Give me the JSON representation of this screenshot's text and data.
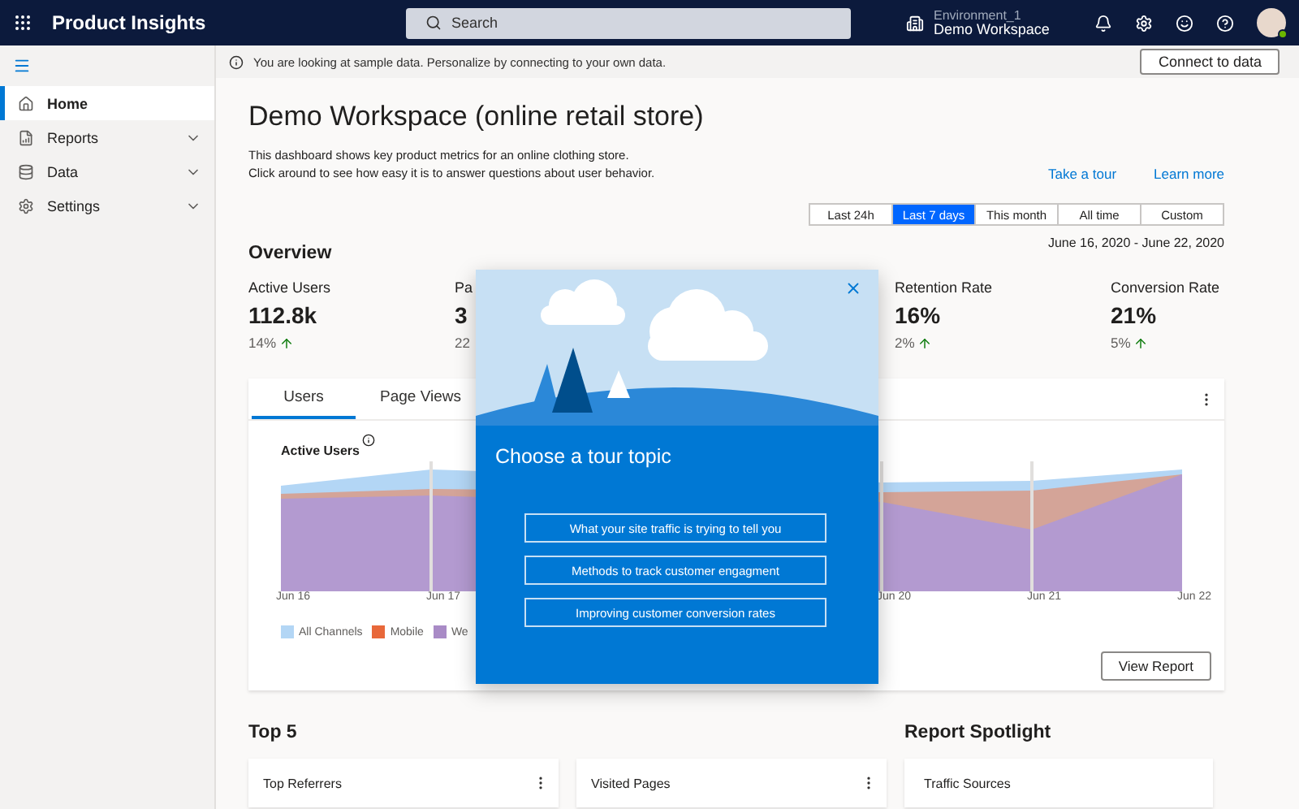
{
  "header": {
    "app_title": "Product Insights",
    "search": {
      "placeholder": "Search"
    },
    "environment": {
      "name": "Environment_1",
      "workspace": "Demo Workspace"
    }
  },
  "sidebar": {
    "items": [
      {
        "label": "Home",
        "selected": true
      },
      {
        "label": "Reports",
        "selected": false,
        "expanded": false
      },
      {
        "label": "Data",
        "selected": false,
        "expanded": false
      },
      {
        "label": "Settings",
        "selected": false,
        "expanded": false
      }
    ]
  },
  "info_bar": {
    "message": "You are looking at sample data. Personalize by connecting to your own data.",
    "button": "Connect to data"
  },
  "page": {
    "title": "Demo Workspace (online retail store)",
    "description": [
      "This dashboard shows key product metrics for an online clothing store.",
      "Click around to see how easy it is to answer questions about user behavior."
    ],
    "links": [
      "Take a tour",
      "Learn more"
    ]
  },
  "date_ranges": [
    {
      "label": "Last 24h",
      "selected": false
    },
    {
      "label": "Last 7 days",
      "selected": true
    },
    {
      "label": "This month",
      "selected": false
    },
    {
      "label": "All time",
      "selected": false
    },
    {
      "label": "Custom",
      "selected": false
    }
  ],
  "date_span": "June 16, 2020 - June 22, 2020",
  "overview": {
    "title": "Overview",
    "metrics": [
      {
        "label": "Active Users",
        "value": "112.8k",
        "change": "14%",
        "up": true
      },
      {
        "label": "Pa",
        "value": "3",
        "change": "22"
      },
      {
        "label": "Retention Rate",
        "value": "16%",
        "change": "2%",
        "up": true
      },
      {
        "label": "Conversion Rate",
        "value": "21%",
        "change": "5%",
        "up": true
      }
    ]
  },
  "chart_card": {
    "tabs": [
      {
        "label": "Users",
        "selected": true
      },
      {
        "label": "Page Views",
        "selected": false
      }
    ],
    "chart_title": "Active Users",
    "x_labels": [
      "Jun 16",
      "Jun 17",
      "Jun 20",
      "Jun 21",
      "Jun 22"
    ],
    "legend": [
      {
        "label": "All Channels",
        "color": "#b3d6f5"
      },
      {
        "label": "Mobile",
        "color": "#e8683a"
      },
      {
        "label": "We",
        "color": "#a98bc6"
      }
    ],
    "button": "View Report"
  },
  "top5": {
    "title": "Top 5",
    "cards": [
      "Top Referrers",
      "Visited Pages"
    ]
  },
  "spotlight": {
    "title": "Report Spotlight",
    "cards": [
      "Traffic Sources"
    ]
  },
  "tour_dialog": {
    "title": "Choose a tour topic",
    "options": [
      "What your site traffic is trying to tell you",
      "Methods to track customer engagment",
      "Improving customer conversion rates"
    ]
  }
}
